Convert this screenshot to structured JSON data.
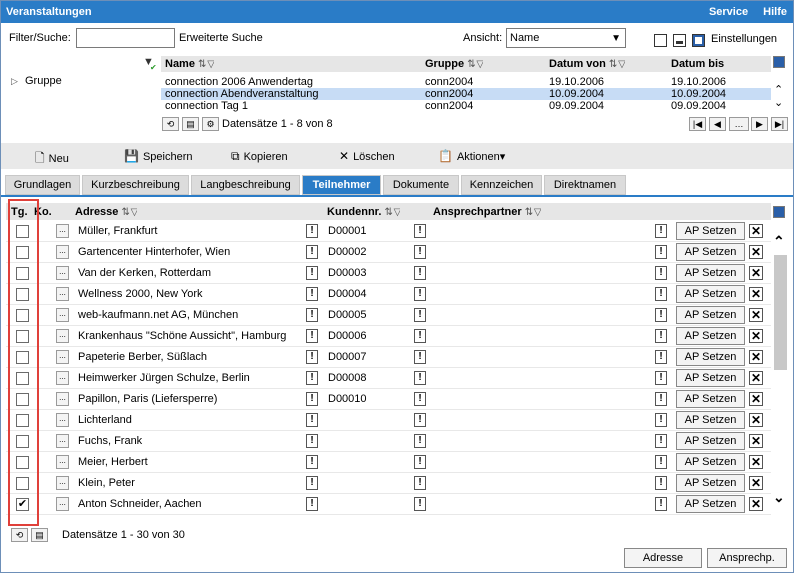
{
  "window": {
    "title": "Veranstaltungen",
    "service_link": "Service",
    "help_link": "Hilfe"
  },
  "filter": {
    "label": "Filter/Suche:",
    "value": "",
    "extended_search": "Erweiterte Suche",
    "view_label": "Ansicht:",
    "view_value": "Name",
    "settings": "Einstellungen"
  },
  "group": {
    "label": "Gruppe"
  },
  "events": {
    "columns": [
      "Name",
      "Gruppe",
      "Datum von",
      "Datum bis"
    ],
    "rows": [
      {
        "name": "connection 2006 Anwendertag",
        "group": "conn2004",
        "from": "19.10.2006",
        "to": "19.10.2006"
      },
      {
        "name": "connection Abendveranstaltung",
        "group": "conn2004",
        "from": "10.09.2004",
        "to": "10.09.2004"
      },
      {
        "name": "connection Tag 1",
        "group": "conn2004",
        "from": "09.09.2004",
        "to": "09.09.2004"
      }
    ],
    "records": "Datensätze 1 - 8 von 8"
  },
  "toolbar": {
    "new": "Neu",
    "save": "Speichern",
    "copy": "Kopieren",
    "delete": "Löschen",
    "actions": "Aktionen"
  },
  "tabs": [
    "Grundlagen",
    "Kurzbeschreibung",
    "Langbeschreibung",
    "Teilnehmer",
    "Dokumente",
    "Kennzeichen",
    "Direktnamen"
  ],
  "participants": {
    "columns": {
      "tg": "Tg.",
      "ko": "Ko.",
      "address": "Adresse",
      "customer_no": "Kundennr.",
      "contact": "Ansprechpartner"
    },
    "ap_label": "AP Setzen",
    "rows": [
      {
        "address": "Müller, Frankfurt",
        "no": "D00001",
        "checked": false
      },
      {
        "address": "Gartencenter Hinterhofer, Wien",
        "no": "D00002",
        "checked": false
      },
      {
        "address": "Van der Kerken, Rotterdam",
        "no": "D00003",
        "checked": false
      },
      {
        "address": "Wellness 2000, New York",
        "no": "D00004",
        "checked": false
      },
      {
        "address": "web-kaufmann.net AG, München",
        "no": "D00005",
        "checked": false
      },
      {
        "address": "Krankenhaus \"Schöne Aussicht\", Hamburg",
        "no": "D00006",
        "checked": false
      },
      {
        "address": "Papeterie Berber, Süßlach",
        "no": "D00007",
        "checked": false
      },
      {
        "address": "Heimwerker Jürgen Schulze, Berlin",
        "no": "D00008",
        "checked": false
      },
      {
        "address": "Papillon, Paris (Liefersperre)",
        "no": "D00010",
        "checked": false
      },
      {
        "address": "Lichterland",
        "no": "",
        "checked": false
      },
      {
        "address": "Fuchs, Frank",
        "no": "",
        "checked": false
      },
      {
        "address": "Meier, Herbert",
        "no": "",
        "checked": false
      },
      {
        "address": "Klein, Peter",
        "no": "",
        "checked": false
      },
      {
        "address": "Anton Schneider, Aachen",
        "no": "",
        "checked": true
      }
    ],
    "records": "Datensätze 1 - 30 von 30"
  },
  "bottom_buttons": {
    "address": "Adresse",
    "contact": "Ansprechp."
  }
}
